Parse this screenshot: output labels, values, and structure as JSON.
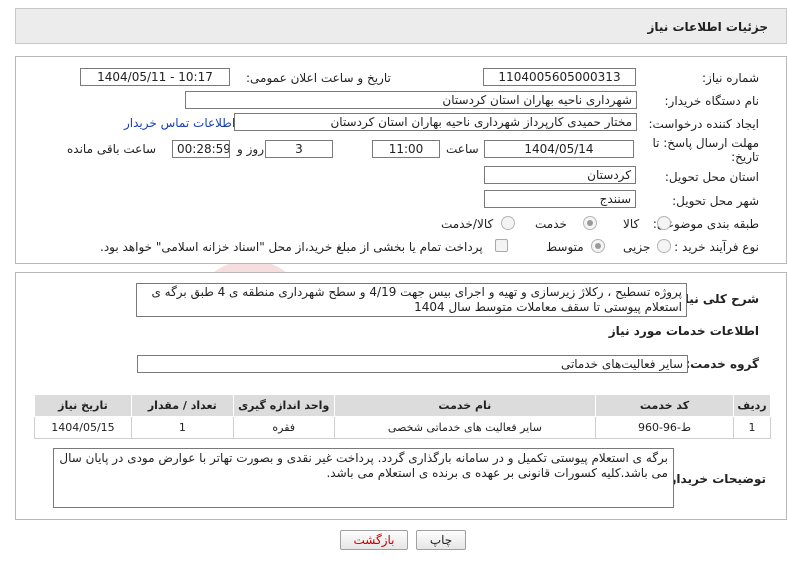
{
  "header": {
    "title": "جزئیات اطلاعات نیاز"
  },
  "form": {
    "need_number_label": "شماره نیاز:",
    "need_number": "1104005605000313",
    "announce_label": "تاریخ و ساعت اعلان عمومی:",
    "announce_value": "1404/05/11 - 10:17",
    "buyer_label": "نام دستگاه خریدار:",
    "buyer_value": "شهرداری ناحیه بهاران استان کردستان",
    "creator_label": "ایجاد کننده درخواست:",
    "creator_value": "مختار حمیدی کارپرداز شهرداری ناحیه بهاران استان کردستان",
    "contact_link": "اطلاعات تماس خریدار",
    "deadline_label": "مهلت ارسال پاسخ: تا تاریخ:",
    "deadline_date": "1404/05/14",
    "time_label": "ساعت",
    "deadline_time": "11:00",
    "days_value": "3",
    "days_label": "روز و",
    "remaining_time": "00:28:59",
    "remaining_label": "ساعت باقی مانده",
    "province_label": "استان محل تحویل:",
    "province_value": "کردستان",
    "city_label": "شهر محل تحویل:",
    "city_value": "سنندج",
    "category_label": "طبقه بندی موضوعی:",
    "category_options": [
      "کالا",
      "خدمت",
      "کالا/خدمت"
    ],
    "category_selected": "خدمت",
    "process_label": "نوع فرآیند خرید :",
    "process_options": [
      "جزیی",
      "متوسط"
    ],
    "process_selected": "متوسط",
    "payment_note": "پرداخت تمام یا بخشی از مبلغ خرید،از محل \"اسناد خزانه اسلامی\" خواهد بود."
  },
  "summary": {
    "label": "شرح کلی نیاز:",
    "text": "پروژه تسطیح ، رکلاژ زیرسازی  و تهیه و اجرای بیس  جهت  4/19  و سطح شهرداری منطقه ی 4 طبق برگه ی استعلام پیوستی تا سقف معاملات متوسط سال 1404"
  },
  "services": {
    "section_title": "اطلاعات خدمات مورد نیاز",
    "group_label": "گروه خدمت:",
    "group_value": "سایر فعالیت‌های خدماتی",
    "columns": [
      "ردیف",
      "کد خدمت",
      "نام خدمت",
      "واحد اندازه گیری",
      "تعداد / مقدار",
      "تاریخ نیاز"
    ],
    "rows": [
      {
        "row": "1",
        "code": "ط-96-960",
        "name": "سایر فعالیت های خدماتی شخصی",
        "unit": "فقره",
        "qty": "1",
        "date": "1404/05/15"
      }
    ]
  },
  "buyer_notes": {
    "label": "توضیحات خریدار:",
    "text": "برگه ی استعلام پیوستی تکمیل و در سامانه بارگذاری گردد. پرداخت غیر نقدی و بصورت تهاتر با عوارض مودی در پایان سال می باشد.کلیه کسورات قانونی بر عهده ی برنده ی استعلام می باشد."
  },
  "buttons": {
    "print": "چاپ",
    "back": "بازگشت"
  },
  "watermark": "AriaTender.neT",
  "colors": {
    "link": "#1a3fb0",
    "back_text": "#cc0000",
    "watermark": "#f1caca"
  }
}
